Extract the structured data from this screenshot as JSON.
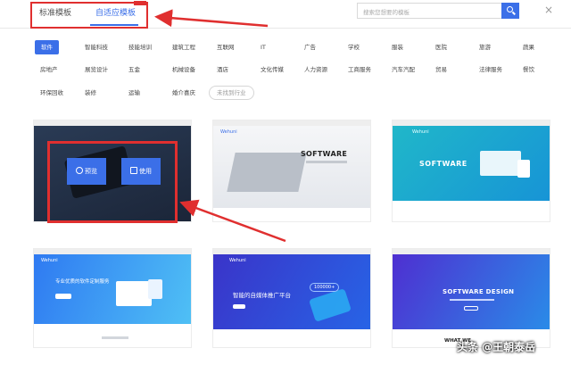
{
  "header": {
    "tabs": [
      {
        "label": "标准模板"
      },
      {
        "label": "自适应模板"
      }
    ],
    "search": {
      "placeholder": "搜索您想要的模板"
    },
    "close_glyph": "×"
  },
  "categories": {
    "row1": [
      "软件",
      "智能科技",
      "技能培训",
      "建筑工程",
      "互联网",
      "IT",
      "广告",
      "学校",
      "服装",
      "医院",
      "旅游",
      "蔬果"
    ],
    "row2": [
      "房地产",
      "展览设计",
      "五金",
      "机械设备",
      "酒店",
      "文化传媒",
      "人力资源",
      "工商服务",
      "汽车汽配",
      "贸易",
      "法律服务",
      "餐饮"
    ],
    "row3": [
      "环保回收",
      "装修",
      "运输",
      "婚介喜庆"
    ],
    "not_found_label": "未找到行业",
    "active": "软件"
  },
  "cards": [
    {
      "actions": {
        "preview": "预览",
        "use": "使用"
      }
    },
    {
      "brand": "Wehuni",
      "title": "SOFTWARE"
    },
    {
      "brand": "Wehuni",
      "title": "SOFTWARE"
    },
    {
      "brand": "Wehuni",
      "headline": "专业优质的软件定制服务"
    },
    {
      "brand": "Wehuni",
      "headline": "智能的自媒体推广平台",
      "badge": "100000+"
    },
    {
      "title": "SOFTWARE DESIGN",
      "footer": "WHAT WE"
    }
  ],
  "watermark": "头条 @王朝泰岳",
  "colors": {
    "accent": "#3b6fe8",
    "annotation": "#e02f2f"
  }
}
